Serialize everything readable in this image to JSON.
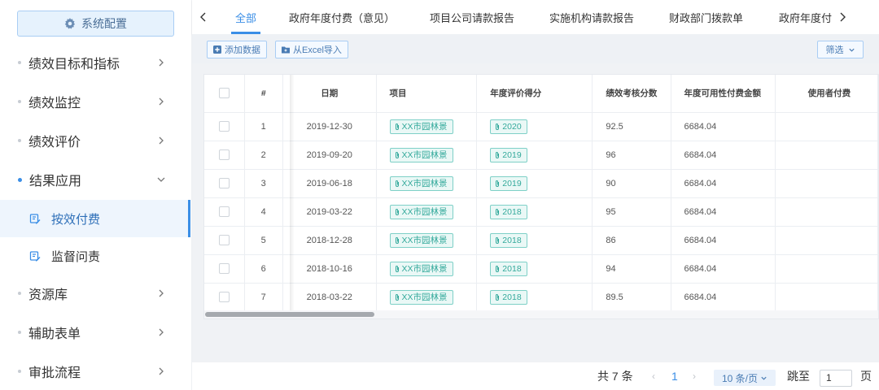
{
  "sidebar": {
    "config_button": "系统配置",
    "items": [
      {
        "label": "绩效目标和指标"
      },
      {
        "label": "绩效监控"
      },
      {
        "label": "绩效评价"
      },
      {
        "label": "结果应用"
      },
      {
        "label": "资源库"
      },
      {
        "label": "辅助表单"
      },
      {
        "label": "审批流程"
      }
    ],
    "sub_items": [
      {
        "label": "按效付费",
        "selected": true
      },
      {
        "label": "监督问责",
        "selected": false
      }
    ]
  },
  "tabs": [
    {
      "label": "全部",
      "active": true
    },
    {
      "label": "政府年度付费（意见）"
    },
    {
      "label": "项目公司请款报告"
    },
    {
      "label": "实施机构请款报告"
    },
    {
      "label": "财政部门拨款单"
    },
    {
      "label": "政府年度付"
    }
  ],
  "toolbar": {
    "add_label": "添加数据",
    "import_label": "从Excel导入",
    "filter_label": "筛选"
  },
  "table": {
    "headers": {
      "index": "#",
      "date": "日期",
      "project": "项目",
      "score": "年度评价得分",
      "assess": "绩效考核分数",
      "amount": "年度可用性付费金额",
      "user_pay": "使用者付费"
    },
    "rows": [
      {
        "index": "1",
        "date": "2019-12-30",
        "project": "XX市园林景",
        "score": "2020",
        "assess": "92.5",
        "amount": "6684.04"
      },
      {
        "index": "2",
        "date": "2019-09-20",
        "project": "XX市园林景",
        "score": "2019",
        "assess": "96",
        "amount": "6684.04"
      },
      {
        "index": "3",
        "date": "2019-06-18",
        "project": "XX市园林景",
        "score": "2019",
        "assess": "90",
        "amount": "6684.04"
      },
      {
        "index": "4",
        "date": "2019-03-22",
        "project": "XX市园林景",
        "score": "2018",
        "assess": "95",
        "amount": "6684.04"
      },
      {
        "index": "5",
        "date": "2018-12-28",
        "project": "XX市园林景",
        "score": "2018",
        "assess": "86",
        "amount": "6684.04"
      },
      {
        "index": "6",
        "date": "2018-10-16",
        "project": "XX市园林景",
        "score": "2018",
        "assess": "94",
        "amount": "6684.04"
      },
      {
        "index": "7",
        "date": "2018-03-22",
        "project": "XX市园林景",
        "score": "2018",
        "assess": "89.5",
        "amount": "6684.04"
      }
    ]
  },
  "pagination": {
    "total": "共 7 条",
    "current_page": "1",
    "page_size": "10 条/页",
    "jump_label": "跳至",
    "jump_value": "1",
    "page_unit": "页"
  },
  "colors": {
    "accent": "#3a8ee6",
    "tag_border": "#7ed0c7",
    "tag_text": "#33a99b"
  }
}
